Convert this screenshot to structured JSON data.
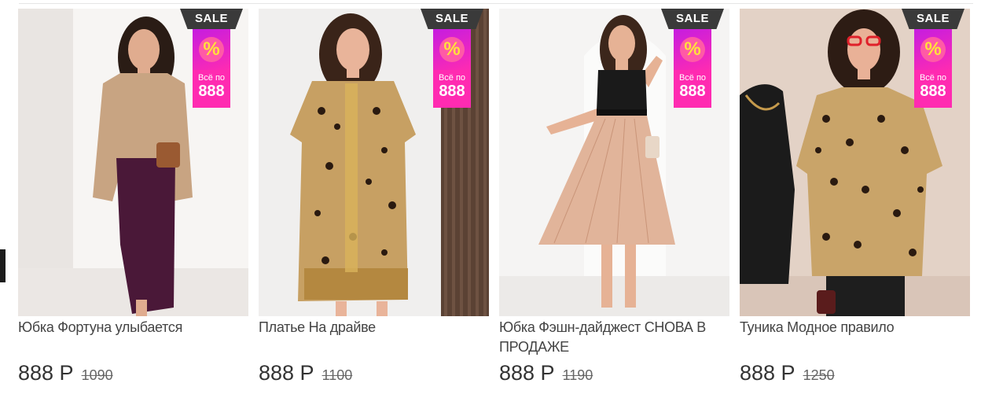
{
  "badge": {
    "sale_label": "SALE",
    "percent_symbol": "%",
    "all_for_label": "Всё по",
    "all_for_price": "888"
  },
  "products": [
    {
      "name": "Юбка Фортуна улыбается",
      "price": "888 Р",
      "old_price": "1090",
      "colors": {
        "bg": "#f3f0ee",
        "top": "#c8a482",
        "bottom": "#4a1838",
        "skin": "#e0ac8f",
        "hair": "#2a1c15"
      }
    },
    {
      "name": "Платье На драйве",
      "price": "888 Р",
      "old_price": "1100",
      "colors": {
        "bg": "#f0efee",
        "top": "#c7a063",
        "bottom": "#c7a063",
        "skin": "#e9b49a",
        "hair": "#3a2419"
      }
    },
    {
      "name": "Юбка Фэшн-дайджест СНОВА В ПРОДАЖЕ",
      "price": "888 Р",
      "old_price": "1190",
      "colors": {
        "bg": "#f5f4f3",
        "top": "#1a1a1a",
        "bottom": "#e1b49a",
        "skin": "#e6b295",
        "hair": "#3c261b"
      }
    },
    {
      "name": "Туника Модное правило",
      "price": "888 Р",
      "old_price": "1250",
      "colors": {
        "bg": "#e3d2c6",
        "top": "#c9a469",
        "bottom": "#1e1e1e",
        "skin": "#e9b197",
        "hair": "#2d1c14"
      }
    }
  ]
}
